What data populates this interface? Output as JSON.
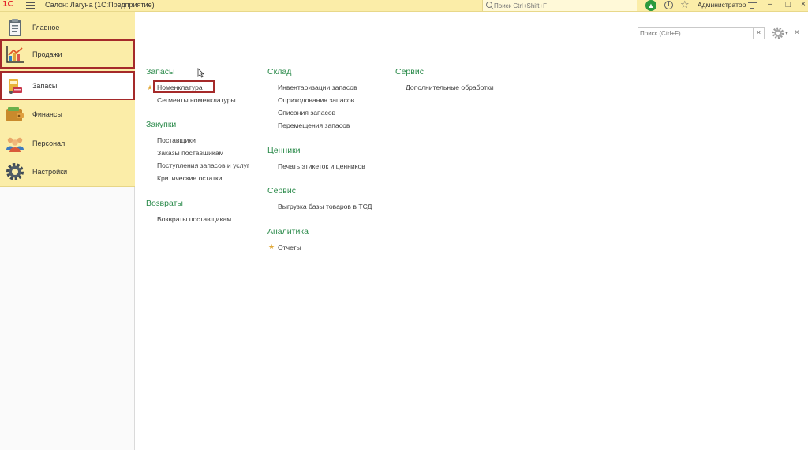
{
  "titlebar": {
    "logo": "1C",
    "title": "Салон: Лагуна  (1С:Предприятие)",
    "search_placeholder": "Поиск Ctrl+Shift+F",
    "user": "Администратор"
  },
  "sidebar": {
    "items": [
      {
        "label": "Главное",
        "icon": "clipboard-icon"
      },
      {
        "label": "Продажи",
        "icon": "sales-chart-icon"
      },
      {
        "label": "Запасы",
        "icon": "stock-icon"
      },
      {
        "label": "Финансы",
        "icon": "wallet-icon"
      },
      {
        "label": "Персонал",
        "icon": "people-icon"
      },
      {
        "label": "Настройки",
        "icon": "gear-icon"
      }
    ]
  },
  "content": {
    "search_placeholder": "Поиск (Ctrl+F)",
    "columns": [
      {
        "sections": [
          {
            "title": "Запасы",
            "links": [
              "Номенклатура",
              "Сегменты номенклатуры"
            ]
          },
          {
            "title": "Закупки",
            "links": [
              "Поставщики",
              "Заказы поставщикам",
              "Поступления запасов и услуг",
              "Критические остатки"
            ]
          },
          {
            "title": "Возвраты",
            "links": [
              "Возвраты поставщикам"
            ]
          }
        ]
      },
      {
        "sections": [
          {
            "title": "Склад",
            "links": [
              "Инвентаризации запасов",
              "Оприходования запасов",
              "Списания запасов",
              "Перемещения запасов"
            ]
          },
          {
            "title": "Ценники",
            "links": [
              "Печать этикеток и ценников"
            ]
          },
          {
            "title": "Сервис",
            "links": [
              "Выгрузка базы товаров в ТСД"
            ]
          },
          {
            "title": "Аналитика",
            "links": [
              "Отчеты"
            ]
          }
        ]
      },
      {
        "sections": [
          {
            "title": "Сервис",
            "links": [
              "Дополнительные обработки"
            ]
          }
        ]
      }
    ]
  },
  "colors": {
    "panel": "#fbeda8",
    "section_title": "#2a8a4a",
    "highlight": "#a52a2a",
    "favorite_star": "#e1a93a"
  }
}
